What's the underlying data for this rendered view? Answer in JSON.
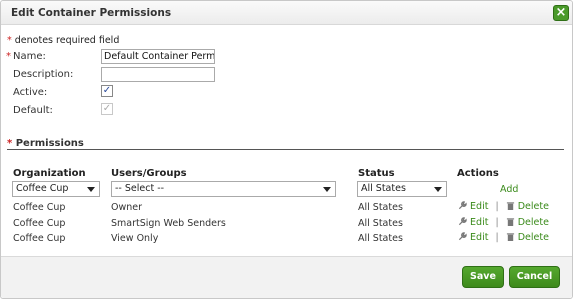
{
  "dialog": {
    "title": "Edit Container Permissions",
    "close_glyph": "×",
    "required_mark": "*",
    "required_note": "denotes required field"
  },
  "form": {
    "name_label": "Name:",
    "name_value": "Default Container Permissions",
    "description_label": "Description:",
    "description_value": "",
    "active_label": "Active:",
    "active_checked": true,
    "default_label": "Default:",
    "default_checked": true,
    "check_glyph": "✓"
  },
  "permissions": {
    "section_title": "Permissions",
    "headers": {
      "organization": "Organization",
      "users_groups": "Users/Groups",
      "status": "Status",
      "actions": "Actions"
    },
    "new_row": {
      "organization": "Coffee Cup",
      "users_groups": "-- Select --",
      "status": "All States",
      "add_label": "Add"
    },
    "rows": [
      {
        "organization": "Coffee Cup",
        "users_groups": "Owner",
        "status": "All States",
        "edit": "Edit",
        "delete": "Delete"
      },
      {
        "organization": "Coffee Cup",
        "users_groups": "SmartSign Web Senders",
        "status": "All States",
        "edit": "Edit",
        "delete": "Delete"
      },
      {
        "organization": "Coffee Cup",
        "users_groups": "View Only",
        "status": "All States",
        "edit": "Edit",
        "delete": "Delete"
      }
    ],
    "separator": "|"
  },
  "footer": {
    "save_label": "Save",
    "cancel_label": "Cancel"
  },
  "colors": {
    "accent_green": "#3e8a1c",
    "link_green": "#3a8a1a",
    "required_red": "#cc2222"
  }
}
